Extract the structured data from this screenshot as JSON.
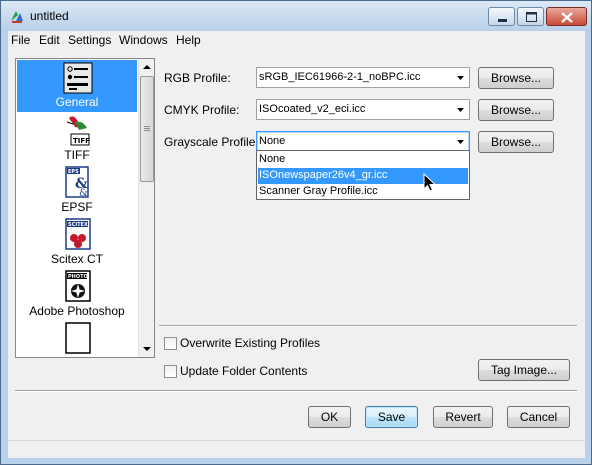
{
  "window": {
    "title": "untitled"
  },
  "menu": {
    "items": [
      "File",
      "Edit",
      "Settings",
      "Windows",
      "Help"
    ]
  },
  "sidebar": {
    "items": [
      {
        "label": "General",
        "icon": "general-settings-icon",
        "selected": true
      },
      {
        "label": "TIFF",
        "icon": "tiff-icon",
        "selected": false
      },
      {
        "label": "EPSF",
        "icon": "epsf-icon",
        "selected": false
      },
      {
        "label": "Scitex CT",
        "icon": "scitex-ct-icon",
        "selected": false
      },
      {
        "label": "Adobe Photoshop",
        "icon": "photoshop-icon",
        "selected": false
      }
    ]
  },
  "profiles": {
    "rgb_label": "RGB Profile:",
    "rgb_value": "sRGB_IEC61966-2-1_noBPC.icc",
    "cmyk_label": "CMYK Profile:",
    "cmyk_value": "ISOcoated_v2_eci.icc",
    "gray_label": "Grayscale Profile:",
    "gray_value": "None",
    "browse_label": "Browse...",
    "gray_options": [
      "None",
      "ISOnewspaper26v4_gr.icc",
      "Scanner Gray Profile.icc"
    ],
    "gray_highlighted": "ISOnewspaper26v4_gr.icc"
  },
  "options": {
    "overwrite_label": "Overwrite Existing Profiles",
    "overwrite_checked": false,
    "update_label": "Update Folder Contents",
    "update_checked": false,
    "tag_image_label": "Tag Image..."
  },
  "buttons": {
    "ok": "OK",
    "save": "Save",
    "revert": "Revert",
    "cancel": "Cancel"
  },
  "colors": {
    "selection": "#3399ff",
    "window_frame": "#b9d1ea",
    "close_button": "#c74a36"
  }
}
